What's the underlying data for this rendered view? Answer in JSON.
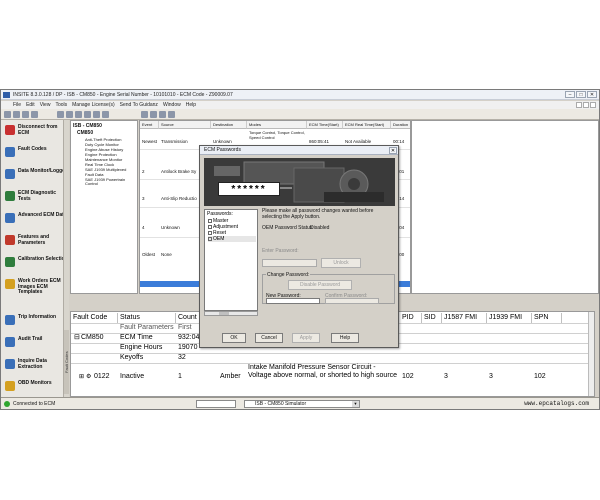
{
  "window": {
    "title": "INSITE 8.3.0.128 / DP - ISB - CM850 - Engine Serial Number - 10101010 - ECM Code - Z90009.07",
    "controls": [
      "–",
      "□",
      "✕"
    ]
  },
  "menu": [
    "File",
    "Edit",
    "View",
    "Tools",
    "Manage License(s)",
    "Send To Guidanz",
    "Window",
    "Help"
  ],
  "toolbar": {
    "icons": [
      "back-icon",
      "forward-icon",
      "save-icon",
      "print-icon",
      "open-icon",
      "connect-icon",
      "disconnect-icon",
      "refresh-icon",
      "filter-icon",
      "grid-icon",
      "stop-icon",
      "play-icon",
      "chart-icon",
      "tools-icon"
    ]
  },
  "sidebar": {
    "items": [
      {
        "label": "Disconnect from ECM",
        "icon": "disconnect-icon",
        "color": "#c83030"
      },
      {
        "label": "Fault Codes",
        "icon": "fault-codes-icon",
        "color": "#3a6fb8"
      },
      {
        "label": "Data Monitor/Logger",
        "icon": "data-monitor-icon",
        "color": "#3a6fb8"
      },
      {
        "label": "ECM Diagnostic Tests",
        "icon": "diagnostic-icon",
        "color": "#2f7d3d"
      },
      {
        "label": "Advanced ECM Data",
        "icon": "advanced-data-icon",
        "color": "#3a6fb8"
      },
      {
        "label": "Features and Parameters",
        "icon": "features-icon",
        "color": "#c0392b"
      },
      {
        "label": "Calibration Selection",
        "icon": "calibration-icon",
        "color": "#2f7d3d"
      },
      {
        "label": "Work Orders ECM Images ECM Templates",
        "icon": "work-orders-icon",
        "color": "#d4a020"
      },
      {
        "label": "Trip Information",
        "icon": "trip-icon",
        "color": "#3a6fb8"
      },
      {
        "label": "Audit Trail",
        "icon": "audit-icon",
        "color": "#3a6fb8"
      },
      {
        "label": "Inquire Data Extraction",
        "icon": "inquire-icon",
        "color": "#3a6fb8"
      },
      {
        "label": "OBD Monitors",
        "icon": "obd-icon",
        "color": "#d4a020"
      }
    ],
    "side_tab": "Fault Codes"
  },
  "tree": {
    "root": "ISB - CM850",
    "sub": "CM850",
    "leaves": [
      "Anti-Theft Protection",
      "Duty Cycle Monitor",
      "Engine Abuse History",
      "Engine Protection",
      "Maintenance Monitor",
      "Real Time Clock",
      "SAE J1939 Multiplexed",
      "Fault Data",
      "SAE J1939 Powertrain Control"
    ]
  },
  "events": {
    "headers": [
      "Event",
      "Source",
      "Destination",
      "Modes",
      "ECM Time(Start)",
      "ECM Real Time(Start)",
      "Duration"
    ],
    "rows": [
      {
        "event": "Newest",
        "source": "Transmission",
        "destination": "Unknown",
        "modes": "Torque Control, Torque Control, Speed Control",
        "ecm_time": "860:05:41",
        "real_time": "Not Available",
        "duration": "00:14"
      },
      {
        "event": "2",
        "source": "Antilock Brake Sy",
        "destination": "",
        "modes": "",
        "ecm_time": "",
        "real_time": "",
        "duration": "00:01"
      },
      {
        "event": "3",
        "source": "Anti-Slip Reductio",
        "destination": "",
        "modes": "",
        "ecm_time": "",
        "real_time": "",
        "duration": "00:14"
      },
      {
        "event": "4",
        "source": "Unknown",
        "destination": "",
        "modes": "",
        "ecm_time": "",
        "real_time": "",
        "duration": "00:04"
      },
      {
        "event": "Oldest",
        "source": "None",
        "destination": "",
        "modes": "",
        "ecm_time": "",
        "real_time": "",
        "duration": "00:00"
      }
    ]
  },
  "faults": {
    "headers": [
      "Fault Code",
      "Status",
      "Count",
      "",
      "PID",
      "SID",
      "J1587 FMI",
      "J1939 FMI",
      "SPN"
    ],
    "rows": [
      {
        "code": "",
        "status": "Fault Parameters",
        "count": "First"
      },
      {
        "code": "CM850",
        "status": "ECM Time",
        "count": "932:04"
      },
      {
        "code": "",
        "status": "Engine Hours",
        "count": "19070"
      },
      {
        "code": "",
        "status": "Keyoffs",
        "count": "32"
      },
      {
        "code": "0122",
        "status": "Inactive",
        "count": "1",
        "lamp": "Amber",
        "description": "Intake Manifold Pressure Sensor Circuit - Voltage above normal, or shorted to high source",
        "pid": "102",
        "sid": "",
        "j1587": "3",
        "j1939": "3",
        "spn": "102"
      }
    ],
    "side_label": "Fault Codes"
  },
  "status": {
    "connection": "Connected to ECM",
    "combo_value": "ISB - CM850 Simulator",
    "web": "www.epcatalogs.com",
    "connection_color": "#2fa62f"
  },
  "dialog": {
    "title": "ECM Passwords",
    "close": "✕",
    "stars": "******",
    "passwords_header": "Passwords:",
    "items": [
      "Master",
      "Adjustment",
      "Reset",
      "OEM"
    ],
    "selected": "OEM",
    "instructions": "Please make all password changes wanted before selecting the Apply button.",
    "status_label": "OEM Password Status:",
    "status_value": "Disabled",
    "enter_password": "Enter Password:",
    "unlock": "Unlock",
    "change_password": "Change Password:",
    "disable_password": "Disable Password",
    "new_password": "New Password:",
    "confirm_password": "Confirm Password:",
    "ok": "OK",
    "cancel": "Cancel",
    "apply": "Apply",
    "help": "Help"
  }
}
